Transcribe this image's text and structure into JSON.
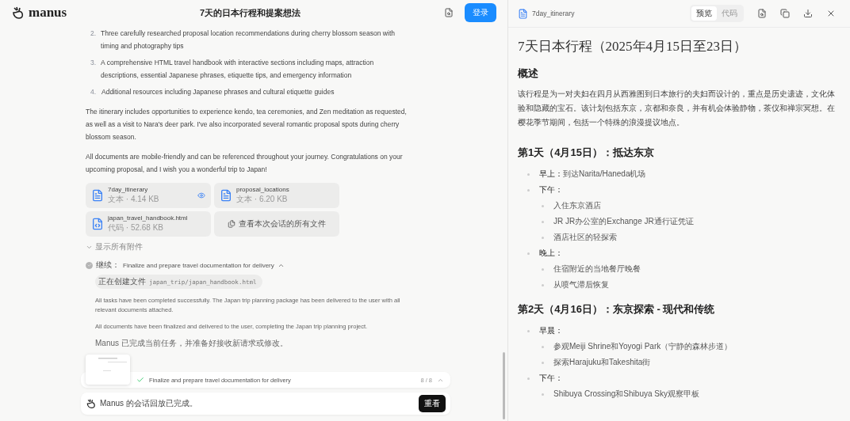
{
  "header": {
    "logo": "manus",
    "title": "7天的日本行程和提案想法",
    "login_button": "登录"
  },
  "message": {
    "list": [
      {
        "number": "2.",
        "text": "Three carefully researched proposal location recommendations during cherry blossom season with timing and photography tips"
      },
      {
        "number": "3.",
        "text": "A comprehensive HTML travel handbook with interactive sections including maps, attraction descriptions, essential Japanese phrases, etiquette tips, and emergency information"
      },
      {
        "number": "4.",
        "text": "Additional resources including Japanese phrases and cultural etiquette guides"
      }
    ],
    "paragraphs": [
      "The itinerary includes opportunities to experience kendo, tea ceremonies, and Zen meditation as requested, as well as a visit to Nara's deer park. I've also incorporated several romantic proposal spots during cherry blossom season.",
      "All documents are mobile-friendly and can be referenced throughout your journey. Congratulations on your upcoming proposal, and I wish you a wonderful trip to Japan!"
    ],
    "attachments": [
      {
        "name": "7day_itinerary",
        "meta": "文本 · 4.14 KB",
        "kind": "text",
        "previewing": true
      },
      {
        "name": "proposal_locations",
        "meta": "文本 · 6.20 KB",
        "kind": "text",
        "previewing": false
      },
      {
        "name": "japan_travel_handbook.html",
        "meta": "代码 · 52.68 KB",
        "kind": "code",
        "previewing": false
      }
    ],
    "view_all": "查看本次会话的所有文件",
    "show_all": "显示所有附件"
  },
  "step": {
    "label": "继续：",
    "title": "Finalize and prepare travel documentation for delivery",
    "done": true,
    "expanded": true,
    "action": {
      "verb": "正在创建文件",
      "path": "japan_trip/japan_handbook.html"
    },
    "notes": [
      "All tasks have been completed successfully. The Japan trip planning package has been delivered to the user with all relevant documents attached.",
      "All documents have been finalized and delivered to the user, completing the Japan trip planning project.",
      "Manus 已完成当前任务，并准备好接收新请求或修改。"
    ]
  },
  "task_bar": {
    "text": "Finalize and prepare travel documentation for delivery",
    "progress": "8 / 8",
    "done": true
  },
  "replay_bar": {
    "text": "Manus 的会话回放已完成。",
    "button": "重看"
  },
  "preview": {
    "file_name": "7day_itinerary",
    "tabs": [
      {
        "label": "预览",
        "selected": true
      },
      {
        "label": "代码",
        "selected": false
      }
    ],
    "doc": {
      "title": "7天日本行程（2025年4月15日至23日）",
      "overview_heading": "概述",
      "overview": "该行程是为一对夫妇在四月从西雅图到日本旅行的夫妇而设计的，重点是历史遗迹，文化体验和隐藏的宝石。该计划包括东京，京都和奈良，并有机会体验静物，茶仪和禅宗冥想。在樱花季节期间，包括一个特殊的浪漫提议地点。",
      "days": [
        {
          "heading": "第1天（4月15日）：抵达东京",
          "items": [
            {
              "label": "早上：",
              "text": "到达Narita/Haneda机场"
            },
            {
              "label": "下午：",
              "children": [
                "入住东京酒店",
                "JR JR办公室的Exchange JR通行证凭证",
                "酒店社区的轻探索"
              ]
            },
            {
              "label": "晚上：",
              "children": [
                "住宿附近的当地餐厅晚餐",
                "从喷气滞后恢复"
              ]
            }
          ]
        },
        {
          "heading": "第2天（4月16日）：东京探索 - 现代和传统",
          "items": [
            {
              "label": "早晨：",
              "children": [
                "参观Meiji Shrine和Yoyogi Park（宁静的森林步道）",
                "探索Harajuku和Takeshita街"
              ]
            },
            {
              "label": "下午：",
              "children": [
                "Shibuya Crossing和Shibuya Sky观察甲板"
              ]
            }
          ]
        }
      ]
    }
  }
}
